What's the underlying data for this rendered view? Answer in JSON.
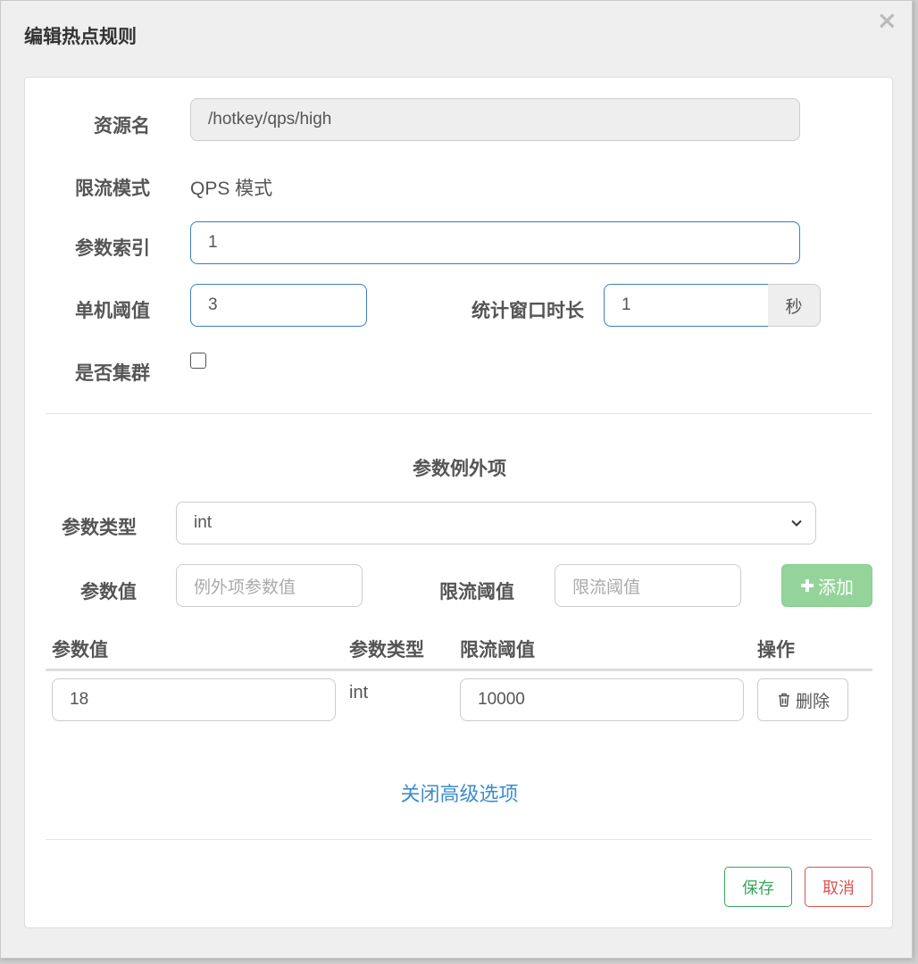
{
  "dialog": {
    "title": "编辑热点规则",
    "close_glyph": "×"
  },
  "form": {
    "resource_label": "资源名",
    "resource_value": "/hotkey/qps/high",
    "mode_label": "限流模式",
    "mode_value": "QPS 模式",
    "param_index_label": "参数索引",
    "param_index_value": "1",
    "threshold_label": "单机阈值",
    "threshold_value": "3",
    "window_label": "统计窗口时长",
    "window_value": "1",
    "window_unit": "秒",
    "cluster_label": "是否集群",
    "cluster_checked": false
  },
  "exceptions": {
    "section_title": "参数例外项",
    "param_type_label": "参数类型",
    "param_type_value": "int",
    "param_value_label": "参数值",
    "param_value_placeholder": "例外项参数值",
    "limit_label": "限流阈值",
    "limit_placeholder": "限流阈值",
    "add_button": "添加",
    "table": {
      "headers": [
        "参数值",
        "参数类型",
        "限流阈值",
        "操作"
      ],
      "rows": [
        {
          "param_value": "18",
          "param_type": "int",
          "limit": "10000",
          "action": "删除"
        }
      ]
    }
  },
  "advanced_link": "关闭高级选项",
  "footer": {
    "save": "保存",
    "cancel": "取消"
  },
  "colors": {
    "focus_border": "#3c7fb7",
    "add_button": "#94d49a",
    "link": "#3c8dcb",
    "save": "#3aa55a",
    "cancel": "#d9534f"
  },
  "icons": [
    "close-icon",
    "chevron-down-icon",
    "plus-icon",
    "trash-icon"
  ]
}
